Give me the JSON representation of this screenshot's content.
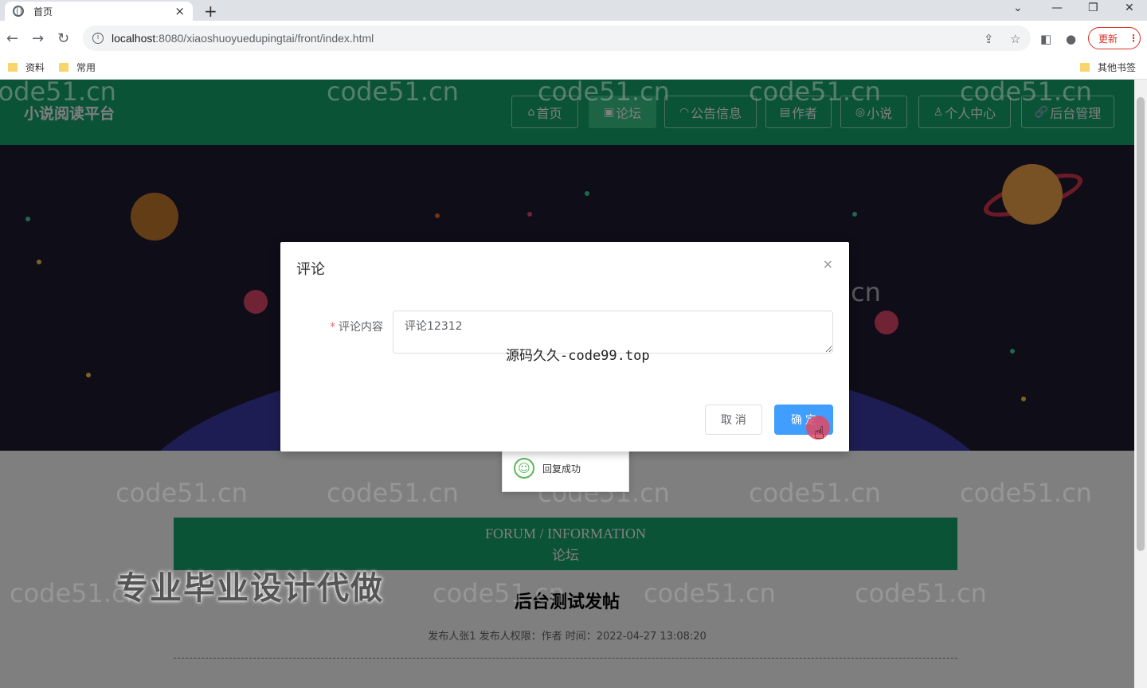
{
  "browser": {
    "tab_title": "首页",
    "tab_close": "×",
    "new_tab": "+",
    "url_host": "localhost",
    "url_rest": ":8080/xiaoshuoyuedupingtai/front/index.html",
    "update_label": "更新",
    "bookmarks": [
      "资料",
      "常用"
    ],
    "other_bookmarks": "其他书签"
  },
  "header": {
    "brand": "小说阅读平台",
    "menu": [
      {
        "label": "首页",
        "icon": "⌂"
      },
      {
        "label": "论坛",
        "icon": "▣"
      },
      {
        "label": "公告信息",
        "icon": "◠"
      },
      {
        "label": "作者",
        "icon": "▤"
      },
      {
        "label": "小说",
        "icon": "◎"
      },
      {
        "label": "个人中心",
        "icon": "♙"
      },
      {
        "label": "后台管理",
        "icon": "🔗"
      }
    ]
  },
  "content": {
    "forum_en": "FORUM / INFORMATION",
    "forum_cn": "论坛",
    "post_title": "后台测试发帖",
    "post_meta": "发布人张1   发布人权限：作者   时间：2022-04-27 13:08:20"
  },
  "dialog": {
    "title": "评论",
    "close": "×",
    "field_label": "评论内容",
    "required_mark": "*",
    "textarea_value": "评论12312",
    "cancel_label": "取 消",
    "ok_label": "确 定"
  },
  "toast": {
    "message": "回复成功"
  },
  "overlay_texts": {
    "code_watermark": "源码久久-code99.top",
    "ad": "专业毕业设计代做",
    "tiled_watermark": "code51.cn"
  }
}
